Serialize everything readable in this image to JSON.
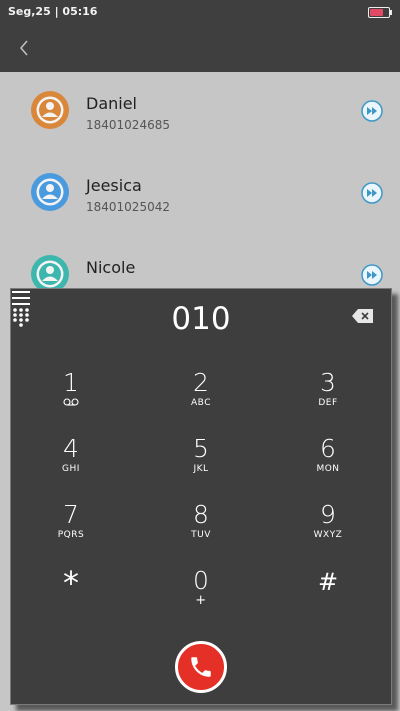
{
  "status": {
    "time": "Seg,25 | 05:16"
  },
  "contacts": [
    {
      "name": "Daniel",
      "number": "18401024685",
      "color": "#d9873a"
    },
    {
      "name": "Jeesica",
      "number": "18401025042",
      "color": "#4a9ae0"
    },
    {
      "name": "Nicole",
      "number": "",
      "color": "#3db7ad"
    }
  ],
  "dialer": {
    "input": "010",
    "keys": [
      {
        "digit": "1",
        "letters": ""
      },
      {
        "digit": "2",
        "letters": "ABC"
      },
      {
        "digit": "3",
        "letters": "DEF"
      },
      {
        "digit": "4",
        "letters": "GHI"
      },
      {
        "digit": "5",
        "letters": "JKL"
      },
      {
        "digit": "6",
        "letters": "MON"
      },
      {
        "digit": "7",
        "letters": "PQRS"
      },
      {
        "digit": "8",
        "letters": "TUV"
      },
      {
        "digit": "9",
        "letters": "WXYZ"
      },
      {
        "digit": "*",
        "letters": ""
      },
      {
        "digit": "0",
        "letters": "+"
      },
      {
        "digit": "#",
        "letters": ""
      }
    ]
  },
  "icons": {
    "back": "back-arrow-icon",
    "voicemail": "voicemail-icon",
    "menu": "menu-icon",
    "call": "phone-icon",
    "keypad": "keypad-icon",
    "backspace": "backspace-icon"
  },
  "colors": {
    "call": "#e53027",
    "header": "#3f3f3f",
    "dialpad": "#3e3e3e"
  }
}
